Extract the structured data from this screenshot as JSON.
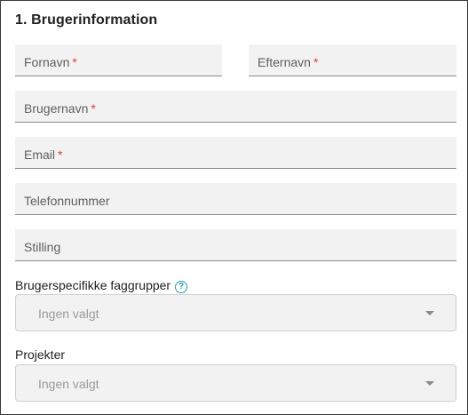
{
  "section": {
    "title": "1. Brugerinformation"
  },
  "fields": {
    "first_name": {
      "label": "Fornavn",
      "required": "*"
    },
    "last_name": {
      "label": "Efternavn",
      "required": "*"
    },
    "username": {
      "label": "Brugernavn",
      "required": "*"
    },
    "email": {
      "label": "Email",
      "required": "*"
    },
    "phone": {
      "label": "Telefonnummer"
    },
    "position": {
      "label": "Stilling"
    }
  },
  "groups": {
    "label": "Brugerspecifikke faggrupper",
    "help_icon": "?",
    "selected": "Ingen valgt"
  },
  "projects": {
    "label": "Projekter",
    "selected": "Ingen valgt"
  },
  "colors": {
    "required": "#e53935",
    "help": "#26a0b6"
  }
}
